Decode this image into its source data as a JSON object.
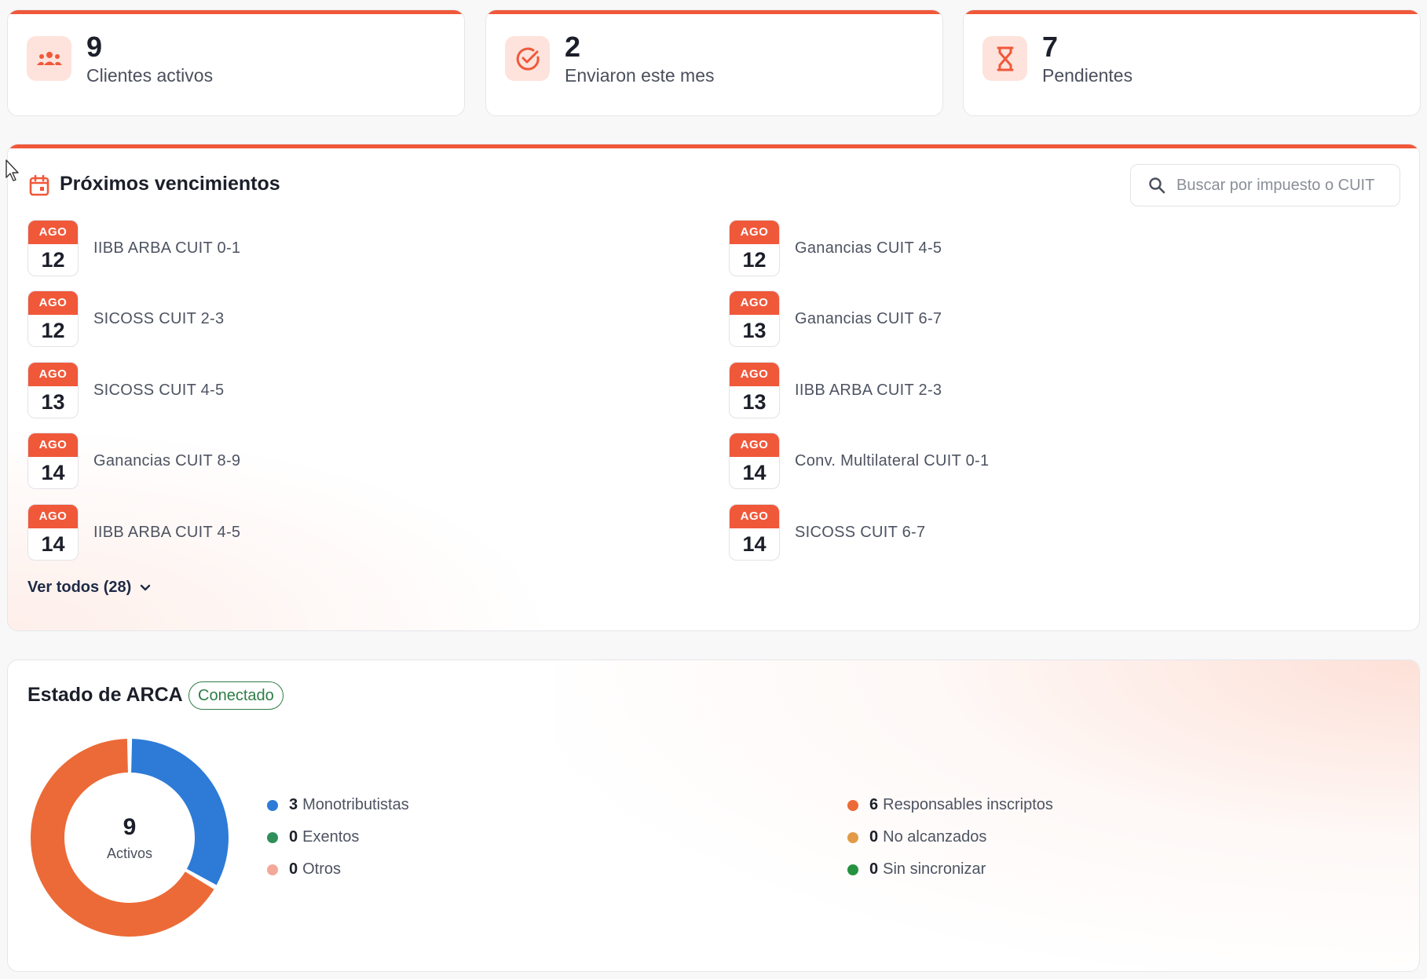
{
  "stats": [
    {
      "value": "9",
      "label": "Clientes activos",
      "icon": "users-icon"
    },
    {
      "value": "2",
      "label": "Enviaron este mes",
      "icon": "check-circle-icon"
    },
    {
      "value": "7",
      "label": "Pendientes",
      "icon": "hourglass-icon"
    }
  ],
  "deadlines": {
    "title": "Próximos vencimientos",
    "search_placeholder": "Buscar por impuesto o CUIT",
    "items": [
      {
        "month": "AGO",
        "day": "12",
        "name": "IIBB ARBA CUIT 0-1"
      },
      {
        "month": "AGO",
        "day": "12",
        "name": "Ganancias CUIT 4-5"
      },
      {
        "month": "AGO",
        "day": "12",
        "name": "SICOSS CUIT 2-3"
      },
      {
        "month": "AGO",
        "day": "13",
        "name": "Ganancias CUIT 6-7"
      },
      {
        "month": "AGO",
        "day": "13",
        "name": "SICOSS CUIT 4-5"
      },
      {
        "month": "AGO",
        "day": "13",
        "name": "IIBB ARBA CUIT 2-3"
      },
      {
        "month": "AGO",
        "day": "14",
        "name": "Ganancias CUIT 8-9"
      },
      {
        "month": "AGO",
        "day": "14",
        "name": "Conv. Multilateral CUIT 0-1"
      },
      {
        "month": "AGO",
        "day": "14",
        "name": "IIBB ARBA CUIT 4-5"
      },
      {
        "month": "AGO",
        "day": "14",
        "name": "SICOSS CUIT 6-7"
      }
    ],
    "see_all": "Ver todos (28)"
  },
  "arca": {
    "title": "Estado de ARCA",
    "status": "Conectado",
    "total": "9",
    "total_label": "Activos",
    "legend_left": [
      {
        "count": "3",
        "label": "Monotributistas",
        "color": "#2d7bd6"
      },
      {
        "count": "0",
        "label": "Exentos",
        "color": "#2f8f5b"
      },
      {
        "count": "0",
        "label": "Otros",
        "color": "#f3a89a"
      }
    ],
    "legend_right": [
      {
        "count": "6",
        "label": "Responsables inscriptos",
        "color": "#ec6a37"
      },
      {
        "count": "0",
        "label": "No alcanzados",
        "color": "#e39a47"
      },
      {
        "count": "0",
        "label": "Sin sincronizar",
        "color": "#25923f"
      }
    ],
    "segments": [
      {
        "label": "Monotributistas",
        "value": 3,
        "color": "#2d7bd6"
      },
      {
        "label": "Responsables inscriptos",
        "value": 6,
        "color": "#ec6a37"
      }
    ]
  },
  "colors": {
    "accent": "#f0583a"
  }
}
